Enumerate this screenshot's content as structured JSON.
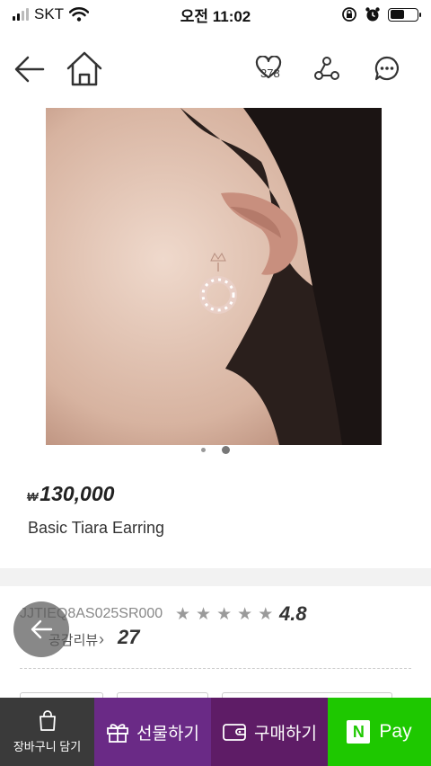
{
  "status_bar": {
    "carrier": "SKT",
    "time": "오전 11:02",
    "battery_level": 0.55
  },
  "nav": {
    "like_count": "378",
    "icons": [
      "back-arrow-icon",
      "home-icon",
      "heart-icon",
      "share-icon",
      "chat-icon"
    ]
  },
  "gallery": {
    "page_count": 2,
    "active_page": 2
  },
  "product": {
    "currency_symbol": "₩",
    "price": "130,000",
    "name": "Basic Tiara Earring",
    "sku": "JJTIEQ8AS025SR000",
    "rating": "4.8",
    "rating_stars": 5,
    "review_label": "공감리뷰",
    "review_count": "27"
  },
  "bottom_bar": {
    "cart_label": "장바구니 담기",
    "gift_label": "선물하기",
    "buy_label": "구매하기",
    "pay_label": "Pay",
    "pay_badge": "N"
  },
  "colors": {
    "gift": "#6a2a86",
    "buy": "#5e1c66",
    "naver_pay": "#1ec800",
    "cart": "#3a3a3a"
  }
}
